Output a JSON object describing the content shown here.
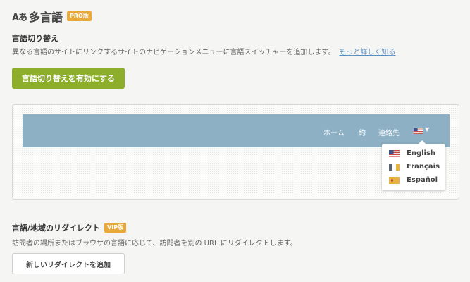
{
  "header": {
    "icon_label": "Aあ",
    "title": "多言語",
    "badge": "PRO版"
  },
  "switcher": {
    "title": "言語切り替え",
    "description": "異なる言語のサイトにリンクするサイトのナビゲーションメニューに言語スイッチャーを追加します。",
    "more_link": "もっと詳しく知る",
    "enable_button": "言語切り替えを有効にする"
  },
  "preview": {
    "nav_items": [
      "ホーム",
      "約",
      "連絡先"
    ],
    "current_flag": "us-flag-icon",
    "languages": [
      {
        "label": "English",
        "flag": "us-flag-icon"
      },
      {
        "label": "Français",
        "flag": "fr-flag-icon"
      },
      {
        "label": "Español",
        "flag": "es-flag-icon"
      }
    ]
  },
  "redirect": {
    "title": "言語/地域のリダイレクト",
    "badge": "VIP版",
    "description": "訪問者の場所またはブラウザの言語に応じて、訪問者を別の URL にリダイレクトします。",
    "add_button": "新しいリダイレクトを追加"
  },
  "colors": {
    "accent_green": "#8dae2a",
    "badge_orange": "#e8a93a",
    "nav_blue": "#8db0c4",
    "link_blue": "#5a8fc0"
  }
}
